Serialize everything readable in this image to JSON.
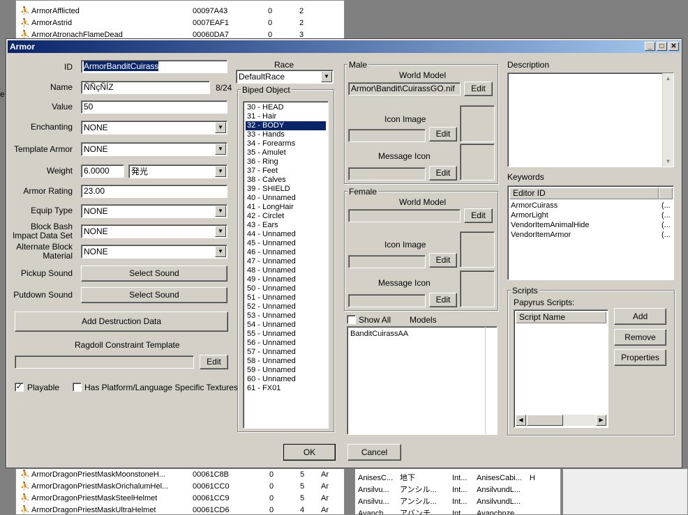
{
  "bg_top": [
    {
      "name": "ArmorAfflicted",
      "id": "00097A43",
      "a": "0",
      "b": "2"
    },
    {
      "name": "ArmorAstrid",
      "id": "0007EAF1",
      "a": "0",
      "b": "2"
    },
    {
      "name": "ArmorAtronachFlameDead",
      "id": "00060DA7",
      "a": "0",
      "b": "3"
    }
  ],
  "bg_bottom": [
    {
      "name": "ArmorDragonPriestMaskMoonstoneH...",
      "id": "00061C8B",
      "a": "0",
      "b": "5",
      "c": "Ar"
    },
    {
      "name": "ArmorDragonPriestMaskOrichalumHel...",
      "id": "00061CC0",
      "a": "0",
      "b": "5",
      "c": "Ar"
    },
    {
      "name": "ArmorDragonPriestMaskSteelHelmet",
      "id": "00061CC9",
      "a": "0",
      "b": "5",
      "c": "Ar"
    },
    {
      "name": "ArmorDragonPriestMaskUltraHelmet",
      "id": "00061CD6",
      "a": "0",
      "b": "4",
      "c": "Ar"
    }
  ],
  "bg_right": [
    {
      "a": "AnisesC...",
      "b": "地下",
      "c": "Int...",
      "d": "AnisesCabi...",
      "e": "H"
    },
    {
      "a": "Ansilvu...",
      "b": "アンシル...",
      "c": "Int...",
      "d": "AnsilvundL...",
      "e": ""
    },
    {
      "a": "Ansilvu...",
      "b": "アンシル...",
      "c": "Int...",
      "d": "AnsilvundL...",
      "e": ""
    },
    {
      "a": "Avanch...",
      "b": "アバンチ...",
      "c": "Int...",
      "d": "Avanchnze...",
      "e": ""
    }
  ],
  "dialog": {
    "title": "Armor",
    "id_label": "ID",
    "id_value": "ArmorBanditCuirass",
    "name_label": "Name",
    "name_value": "ÑÑçÑÍZ",
    "name_count": "8/24",
    "value_label": "Value",
    "value_value": "50",
    "enchanting_label": "Enchanting",
    "enchanting_value": "NONE",
    "template_label": "Template Armor",
    "template_value": "NONE",
    "weight_label": "Weight",
    "weight_value": "6.0000",
    "weight_combo": "発光",
    "rating_label": "Armor Rating",
    "rating_value": "23.00",
    "equip_label": "Equip Type",
    "equip_value": "NONE",
    "bash_label_1": "Block Bash",
    "bash_label_2": "Impact Data Set",
    "bash_value": "NONE",
    "altblock_label_1": "Alternate Block",
    "altblock_label_2": "Material",
    "altblock_value": "NONE",
    "pickup_label": "Pickup Sound",
    "pickup_btn": "Select Sound",
    "putdown_label": "Putdown Sound",
    "putdown_btn": "Select Sound",
    "destruction_btn": "Add Destruction Data",
    "ragdoll_label": "Ragdoll Constraint Template",
    "ragdoll_edit": "Edit",
    "playable_label": "Playable",
    "playable_check": "✓",
    "platform_label": "Has Platform/Language Specific Textures",
    "race_label": "Race",
    "race_value": "DefaultRace",
    "biped_label": "Biped Object",
    "biped": [
      "30 - HEAD",
      "31 - Hair",
      "32 - BODY",
      "33 - Hands",
      "34 - Forearms",
      "35 - Amulet",
      "36 - Ring",
      "37 - Feet",
      "38 - Calves",
      "39 - SHIELD",
      "40 - Unnamed",
      "41 - LongHair",
      "42 - Circlet",
      "43 - Ears",
      "44 - Unnamed",
      "45 - Unnamed",
      "46 - Unnamed",
      "47 - Unnamed",
      "48 - Unnamed",
      "49 - Unnamed",
      "50 - Unnamed",
      "51 - Unnamed",
      "52 - Unnamed",
      "53 - Unnamed",
      "54 - Unnamed",
      "55 - Unnamed",
      "56 - Unnamed",
      "57 - Unnamed",
      "58 - Unnamed",
      "59 - Unnamed",
      "60 - Unnamed",
      "61 - FX01"
    ],
    "male_label": "Male",
    "male_world_label": "World Model",
    "male_world_value": "Armor\\Bandit\\CuirassGO.nif",
    "male_world_edit": "Edit",
    "male_icon_label": "Icon Image",
    "male_icon_edit": "Edit",
    "male_msg_label": "Message Icon",
    "male_msg_edit": "Edit",
    "female_label": "Female",
    "female_world_label": "World Model",
    "female_world_edit": "Edit",
    "female_icon_label": "Icon Image",
    "female_icon_edit": "Edit",
    "female_msg_label": "Message Icon",
    "female_msg_edit": "Edit",
    "showall_label": "Show All",
    "models_label": "Models",
    "models_item": "BanditCuirassAA",
    "desc_label": "Description",
    "keywords_label": "Keywords",
    "kw_col": "Editor ID",
    "keywords": [
      "ArmorCuirass",
      "ArmorLight",
      "VendorItemAnimalHide",
      "VendorItemArmor"
    ],
    "kw_tail": "(...",
    "scripts_label": "Scripts",
    "papyrus_label": "Papyrus Scripts:",
    "script_col": "Script Name",
    "add_btn": "Add",
    "remove_btn": "Remove",
    "properties_btn": "Properties",
    "ok_btn": "OK",
    "cancel_btn": "Cancel"
  }
}
